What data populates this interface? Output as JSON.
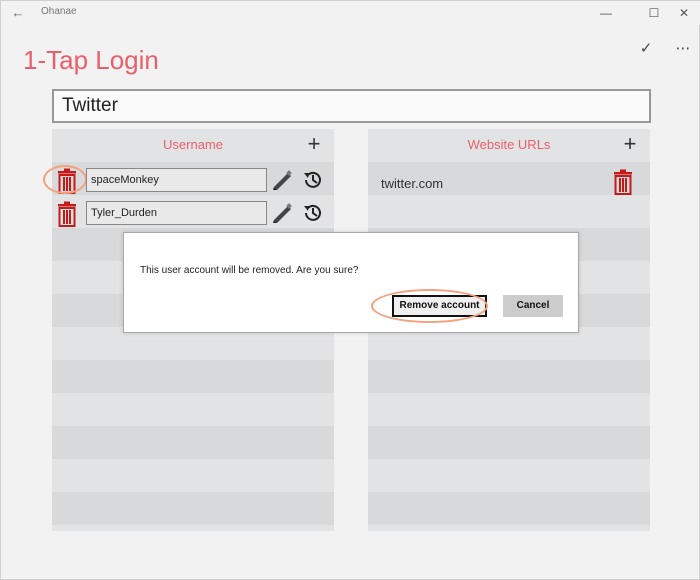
{
  "window": {
    "title": "Ohanae",
    "back_glyph": "←",
    "minimize_glyph": "—",
    "maximize_glyph": "☐",
    "close_glyph": "✕"
  },
  "header": {
    "title": "1-Tap Login",
    "accept_glyph": "✓",
    "more_glyph": "⋯"
  },
  "site_name": "Twitter",
  "usernames": {
    "header": "Username",
    "add_glyph": "+",
    "items": [
      "spaceMonkey",
      "Tyler_Durden"
    ]
  },
  "urls": {
    "header": "Website URLs",
    "add_glyph": "+",
    "items": [
      "twitter.com"
    ]
  },
  "dialog": {
    "message": "This user account will be removed. Are you sure?",
    "confirm_label": "Remove account",
    "cancel_label": "Cancel"
  },
  "colors": {
    "accent": "#e8616a",
    "trash": "#c41a1a",
    "highlight": "#f2a27e"
  },
  "icons": [
    "back-arrow-icon",
    "checkmark-icon",
    "more-icon",
    "plus-icon",
    "trash-icon",
    "pencil-icon",
    "history-icon"
  ]
}
